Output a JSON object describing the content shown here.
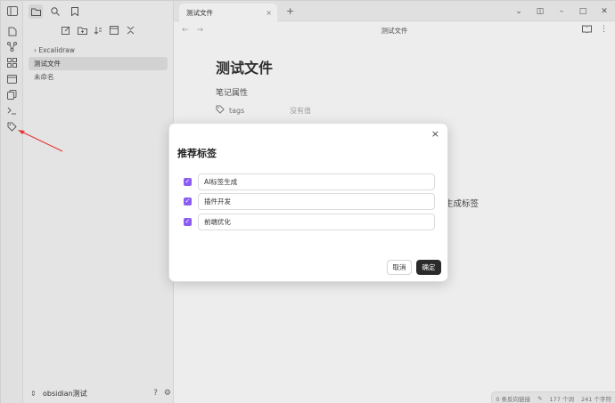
{
  "tab": {
    "title": "测试文件",
    "close": "×",
    "new": "+"
  },
  "window": {
    "layout": "◫",
    "minimize": "–",
    "maximize": "□",
    "close": "✕"
  },
  "nav": {
    "back": "←",
    "forward": "→",
    "breadcrumb": "测试文件",
    "reading_icon": "book-icon",
    "more_icon": "more-icon"
  },
  "sidebar": {
    "tree": [
      {
        "label": "Excalidraw",
        "prefix": "› "
      },
      {
        "label": "测试文件",
        "prefix": ""
      },
      {
        "label": "未命名",
        "prefix": ""
      }
    ],
    "vault_name": "obsidian测试",
    "help": "?",
    "settings": "⚙"
  },
  "document": {
    "title": "测试文件",
    "properties_label": "笔记属性",
    "property_key": "tags",
    "property_value": "没有值",
    "body_fragment": "生成标签"
  },
  "status_bar": {
    "backlinks": "0 条反向链接",
    "words": "177 个词",
    "chars": "241 个字符"
  },
  "modal": {
    "title": "推荐标签",
    "close": "×",
    "tags": [
      {
        "label": "AI标签生成",
        "checked": true
      },
      {
        "label": "插件开发",
        "checked": true
      },
      {
        "label": "前端优化",
        "checked": true
      }
    ],
    "cancel_label": "取消",
    "confirm_label": "确定"
  },
  "colors": {
    "accent": "#8a5cf5",
    "annotation_arrow": "#e53935",
    "confirm_bg": "#2b2b2b"
  }
}
